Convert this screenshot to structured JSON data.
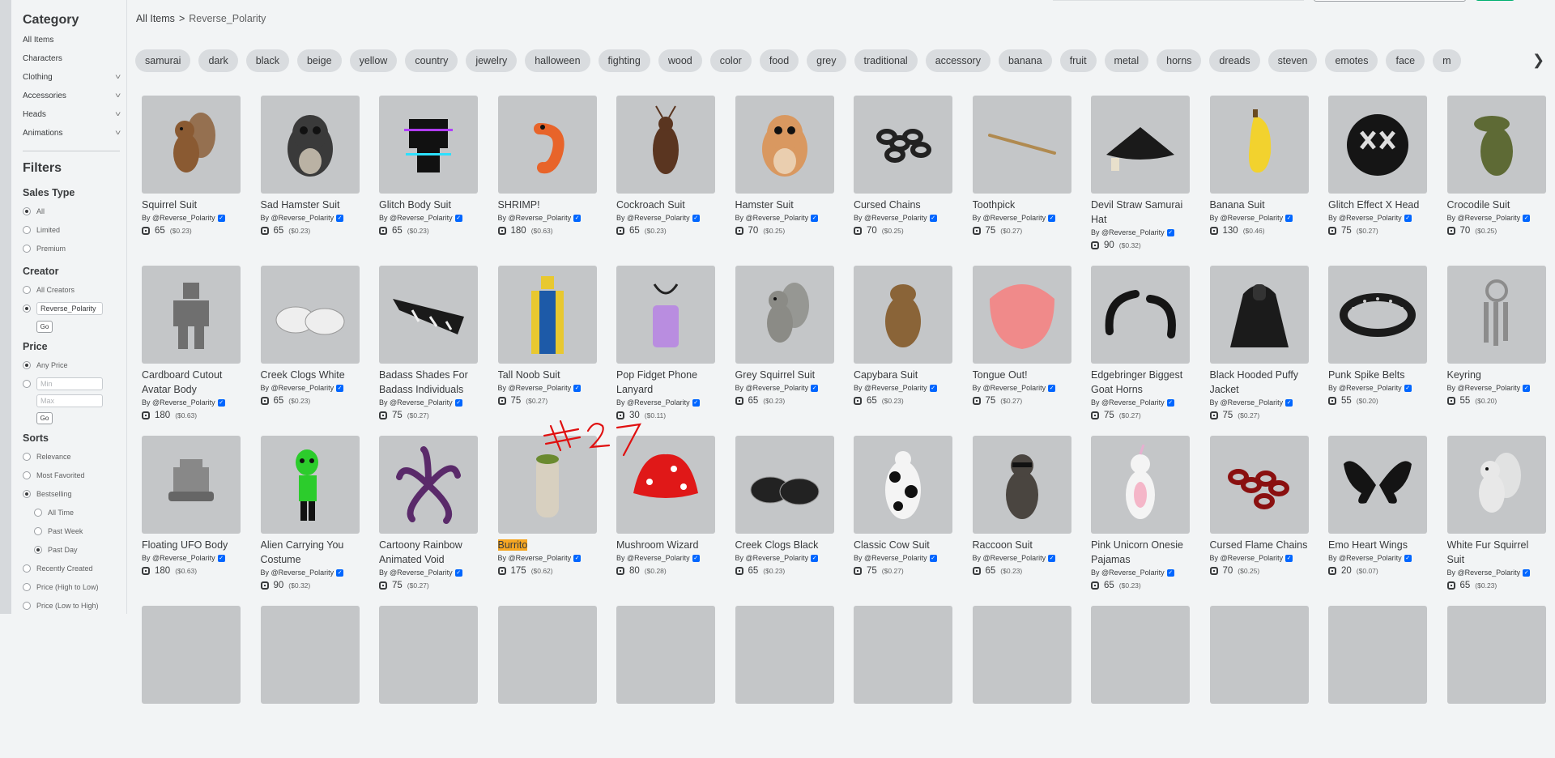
{
  "breadcrumb": {
    "root": "All Items",
    "sep": ">",
    "current": "Reverse_Polarity"
  },
  "sidebar": {
    "category_title": "Category",
    "categories": [
      {
        "label": "All Items",
        "chev": false
      },
      {
        "label": "Characters",
        "chev": false
      },
      {
        "label": "Clothing",
        "chev": true
      },
      {
        "label": "Accessories",
        "chev": true
      },
      {
        "label": "Heads",
        "chev": true
      },
      {
        "label": "Animations",
        "chev": true
      }
    ],
    "filters_title": "Filters",
    "sales_type": {
      "title": "Sales Type",
      "options": [
        "All",
        "Limited",
        "Premium"
      ],
      "selected": 0
    },
    "creator": {
      "title": "Creator",
      "all_label": "All Creators",
      "value": "Reverse_Polarity",
      "go": "Go"
    },
    "price": {
      "title": "Price",
      "any_label": "Any Price",
      "min_placeholder": "Min",
      "max_placeholder": "Max",
      "go": "Go"
    },
    "sorts": {
      "title": "Sorts",
      "options": [
        "Relevance",
        "Most Favorited",
        "Bestselling",
        "All Time",
        "Past Week",
        "Past Day",
        "Recently Created",
        "Price (High to Low)",
        "Price (Low to High)"
      ],
      "selected": [
        "Bestselling",
        "Past Day"
      ],
      "sub": [
        "All Time",
        "Past Week",
        "Past Day"
      ]
    }
  },
  "tags": [
    "samurai",
    "dark",
    "black",
    "beige",
    "yellow",
    "country",
    "jewelry",
    "halloween",
    "fighting",
    "wood",
    "color",
    "food",
    "grey",
    "traditional",
    "accessory",
    "banana",
    "fruit",
    "metal",
    "horns",
    "dreads",
    "steven",
    "emotes",
    "face",
    "m"
  ],
  "creator_label": "By @Reverse_Polarity",
  "items": [
    {
      "name": "Squirrel Suit",
      "robux": "65",
      "usd": "($0.23)",
      "icon": "squirrel-icon",
      "color": "#8a5a32"
    },
    {
      "name": "Sad Hamster Suit",
      "robux": "65",
      "usd": "($0.23)",
      "icon": "hamster-icon",
      "color": "#3a3a3a"
    },
    {
      "name": "Glitch Body Suit",
      "robux": "65",
      "usd": "($0.23)",
      "icon": "glitch-body-icon",
      "color": "#111111"
    },
    {
      "name": "SHRIMP!",
      "robux": "180",
      "usd": "($0.63)",
      "icon": "shrimp-icon",
      "color": "#e8642a"
    },
    {
      "name": "Cockroach Suit",
      "robux": "65",
      "usd": "($0.23)",
      "icon": "cockroach-icon",
      "color": "#5a3520"
    },
    {
      "name": "Hamster Suit",
      "robux": "70",
      "usd": "($0.25)",
      "icon": "hamster-icon",
      "color": "#d99860"
    },
    {
      "name": "Cursed Chains",
      "robux": "70",
      "usd": "($0.25)",
      "icon": "chains-icon",
      "color": "#222222"
    },
    {
      "name": "Toothpick",
      "robux": "75",
      "usd": "($0.27)",
      "icon": "toothpick-icon",
      "color": "#b08a50"
    },
    {
      "name": "Devil Straw Samurai Hat",
      "robux": "90",
      "usd": "($0.32)",
      "icon": "hat-icon",
      "color": "#1a1a1a"
    },
    {
      "name": "Banana Suit",
      "robux": "130",
      "usd": "($0.46)",
      "icon": "banana-icon",
      "color": "#f2d22e"
    },
    {
      "name": "Glitch Effect X Head",
      "robux": "75",
      "usd": "($0.27)",
      "icon": "x-head-icon",
      "color": "#151515"
    },
    {
      "name": "Crocodile Suit",
      "robux": "70",
      "usd": "($0.25)",
      "icon": "crocodile-icon",
      "color": "#5e6a35"
    },
    {
      "name": "Cardboard Cutout Avatar Body",
      "robux": "180",
      "usd": "($0.63)",
      "icon": "cutout-icon",
      "color": "#6f6f6f"
    },
    {
      "name": "Creek Clogs White",
      "robux": "65",
      "usd": "($0.23)",
      "icon": "clogs-icon",
      "color": "#eeeeee"
    },
    {
      "name": "Badass Shades For Badass Individuals",
      "robux": "75",
      "usd": "($0.27)",
      "icon": "shades-icon",
      "color": "#1a1a1a"
    },
    {
      "name": "Tall Noob Suit",
      "robux": "75",
      "usd": "($0.27)",
      "icon": "noob-icon",
      "color": "#1d5aa8"
    },
    {
      "name": "Pop Fidget Phone Lanyard",
      "robux": "30",
      "usd": "($0.11)",
      "icon": "lanyard-icon",
      "color": "#b98de0"
    },
    {
      "name": "Grey Squirrel Suit",
      "robux": "65",
      "usd": "($0.23)",
      "icon": "squirrel-icon",
      "color": "#8b8b86"
    },
    {
      "name": "Capybara Suit",
      "robux": "65",
      "usd": "($0.23)",
      "icon": "capybara-icon",
      "color": "#8a6438"
    },
    {
      "name": "Tongue Out!",
      "robux": "75",
      "usd": "($0.27)",
      "icon": "tongue-icon",
      "color": "#f08a8a"
    },
    {
      "name": "Edgebringer Biggest Goat Horns",
      "robux": "75",
      "usd": "($0.27)",
      "icon": "horns-icon",
      "color": "#151515"
    },
    {
      "name": "Black Hooded Puffy Jacket",
      "robux": "75",
      "usd": "($0.27)",
      "icon": "jacket-icon",
      "color": "#1b1b1b"
    },
    {
      "name": "Punk Spike Belts",
      "robux": "55",
      "usd": "($0.20)",
      "icon": "belt-icon",
      "color": "#1b1b1b"
    },
    {
      "name": "Keyring",
      "robux": "55",
      "usd": "($0.20)",
      "icon": "keyring-icon",
      "color": "#8c8c8c"
    },
    {
      "name": "Floating UFO Body",
      "robux": "180",
      "usd": "($0.63)",
      "icon": "ufo-icon",
      "color": "#888888"
    },
    {
      "name": "Alien Carrying You Costume",
      "robux": "90",
      "usd": "($0.32)",
      "icon": "alien-icon",
      "color": "#2ccc2c"
    },
    {
      "name": "Cartoony Rainbow Animated Void",
      "robux": "75",
      "usd": "($0.27)",
      "icon": "tentacles-icon",
      "color": "#5a2a6a"
    },
    {
      "name": "Burrito",
      "robux": "175",
      "usd": "($0.62)",
      "icon": "burrito-icon",
      "color": "#d8d0c0",
      "highlight": true
    },
    {
      "name": "Mushroom Wizard",
      "robux": "80",
      "usd": "($0.28)",
      "icon": "mushroom-icon",
      "color": "#e01818"
    },
    {
      "name": "Creek Clogs Black",
      "robux": "65",
      "usd": "($0.23)",
      "icon": "clogs-icon",
      "color": "#222222"
    },
    {
      "name": "Classic Cow Suit",
      "robux": "75",
      "usd": "($0.27)",
      "icon": "cow-icon",
      "color": "#111111"
    },
    {
      "name": "Raccoon Suit",
      "robux": "65",
      "usd": "($0.23)",
      "icon": "raccoon-icon",
      "color": "#4a4540"
    },
    {
      "name": "Pink Unicorn Onesie Pajamas",
      "robux": "65",
      "usd": "($0.23)",
      "icon": "unicorn-icon",
      "color": "#f4b6c8"
    },
    {
      "name": "Cursed Flame Chains",
      "robux": "70",
      "usd": "($0.25)",
      "icon": "flame-chains-icon",
      "color": "#8a1010"
    },
    {
      "name": "Emo Heart Wings",
      "robux": "20",
      "usd": "($0.07)",
      "icon": "wings-icon",
      "color": "#141414"
    },
    {
      "name": "White Fur Squirrel Suit",
      "robux": "65",
      "usd": "($0.23)",
      "icon": "squirrel-icon",
      "color": "#e8e8e8"
    }
  ],
  "annotation": {
    "text": "#27",
    "color": "#e01010"
  }
}
